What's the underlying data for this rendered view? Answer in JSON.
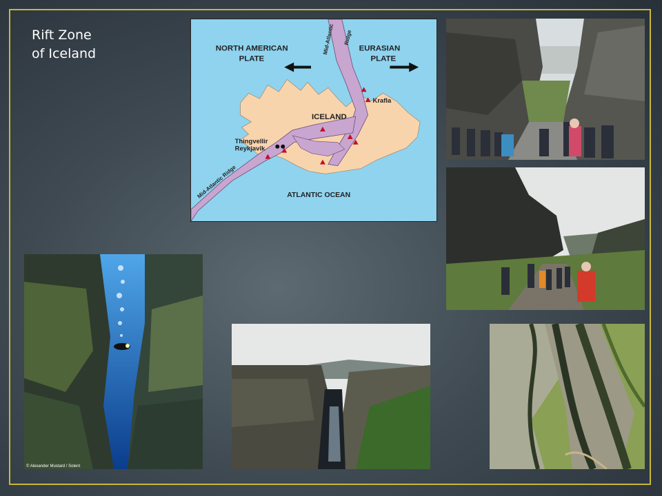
{
  "slide": {
    "title": "Rift Zone\nof Iceland"
  },
  "map": {
    "north_american_plate": [
      "NORTH AMERICAN",
      "PLATE"
    ],
    "eurasian_plate": [
      "EURASIAN",
      "PLATE"
    ],
    "ridge_top": [
      "Mid-Atlantic",
      "Ridge"
    ],
    "ridge_bottom": "Mid-Atlantic Ridge",
    "iceland": "ICELAND",
    "krafla": "Krafla",
    "thingvellir": "Thingvellir",
    "reykjavik": "Reykjavik",
    "atlantic_ocean": "ATLANTIC OCEAN",
    "colors": {
      "ocean": "#8fd3ef",
      "land": "#f8d4ad",
      "rift": "#c9a6cf",
      "volcano": "#c0102a"
    }
  },
  "photos": {
    "underwater_credit": "© Alexander Mustard / Solent"
  }
}
